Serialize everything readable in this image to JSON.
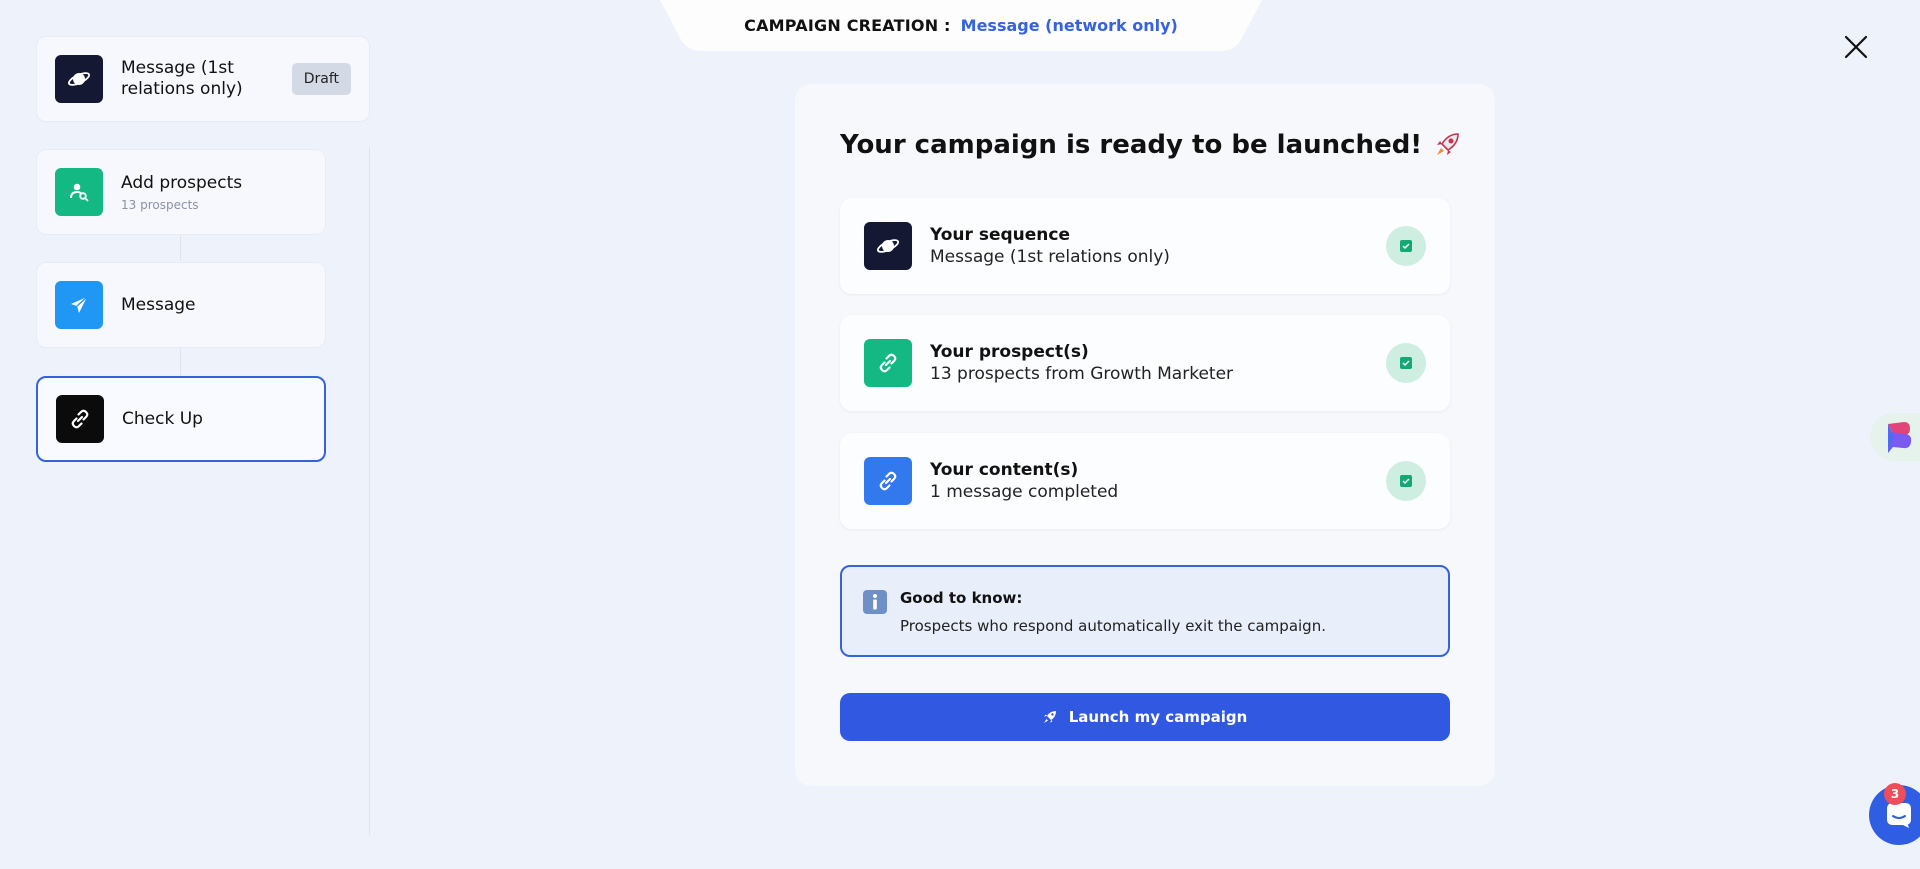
{
  "header": {
    "label": "CAMPAIGN CREATION :",
    "campaign_name": "Message (network only)"
  },
  "sidebar": {
    "sequence": {
      "title": "Message (1st relations only)",
      "status": "Draft",
      "icon": "planet-icon"
    },
    "steps": [
      {
        "title": "Add prospects",
        "subtitle": "13 prospects",
        "icon": "user-search-icon",
        "color": "#14b882"
      },
      {
        "title": "Message",
        "subtitle": "",
        "icon": "paper-plane-icon",
        "color": "#2097f4"
      },
      {
        "title": "Check Up",
        "subtitle": "",
        "icon": "link-icon",
        "color": "#0b0b0b",
        "active": true
      }
    ]
  },
  "main": {
    "heading": "Your campaign is ready to be launched!",
    "heading_emoji": "rocket-icon",
    "checks": [
      {
        "title": "Your sequence",
        "subtitle": "Message (1st relations only)",
        "icon": "planet-icon",
        "status": "checked"
      },
      {
        "title": "Your prospect(s)",
        "subtitle": "13 prospects from Growth Marketer",
        "icon": "link-icon",
        "status": "checked"
      },
      {
        "title": "Your content(s)",
        "subtitle": "1 message completed",
        "icon": "link-icon",
        "status": "checked"
      }
    ],
    "info": {
      "title": "Good to know:",
      "body": "Prospects who respond automatically exit the campaign."
    },
    "launch_label": "Launch my campaign"
  },
  "chat": {
    "unread_count": "3"
  },
  "colors": {
    "accent": "#3158e0",
    "success": "#14b882",
    "background": "#eef2fb"
  }
}
